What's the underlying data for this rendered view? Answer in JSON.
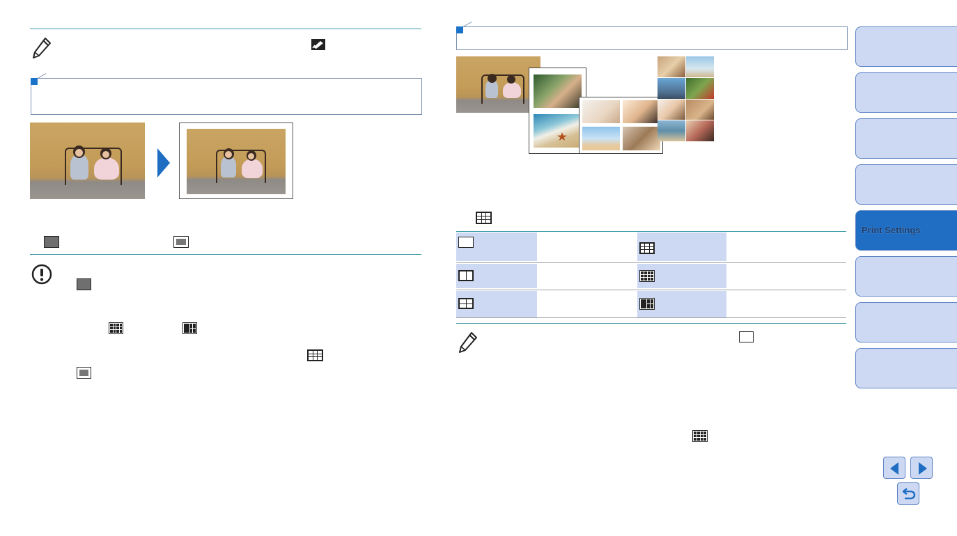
{
  "colors": {
    "accent": "#1f6ec3",
    "tab_bg": "#cdd9f2",
    "rule": "#3a9aa6"
  },
  "icons": {
    "left_note": "pencil-icon",
    "caution": "exclamation-circle-icon",
    "right_note": "pencil-icon",
    "arrow": "right-triangle-arrow-icon",
    "edit_mode": "frame-edit-icon"
  },
  "sidebar": {
    "tabs": [
      {
        "label": ""
      },
      {
        "label": ""
      },
      {
        "label": ""
      },
      {
        "label": ""
      },
      {
        "label": "Print Settings"
      },
      {
        "label": ""
      },
      {
        "label": ""
      },
      {
        "label": ""
      }
    ],
    "active_index": 4
  },
  "nav": {
    "prev": "previous-page-icon",
    "next": "next-page-icon",
    "back": "return-icon"
  }
}
